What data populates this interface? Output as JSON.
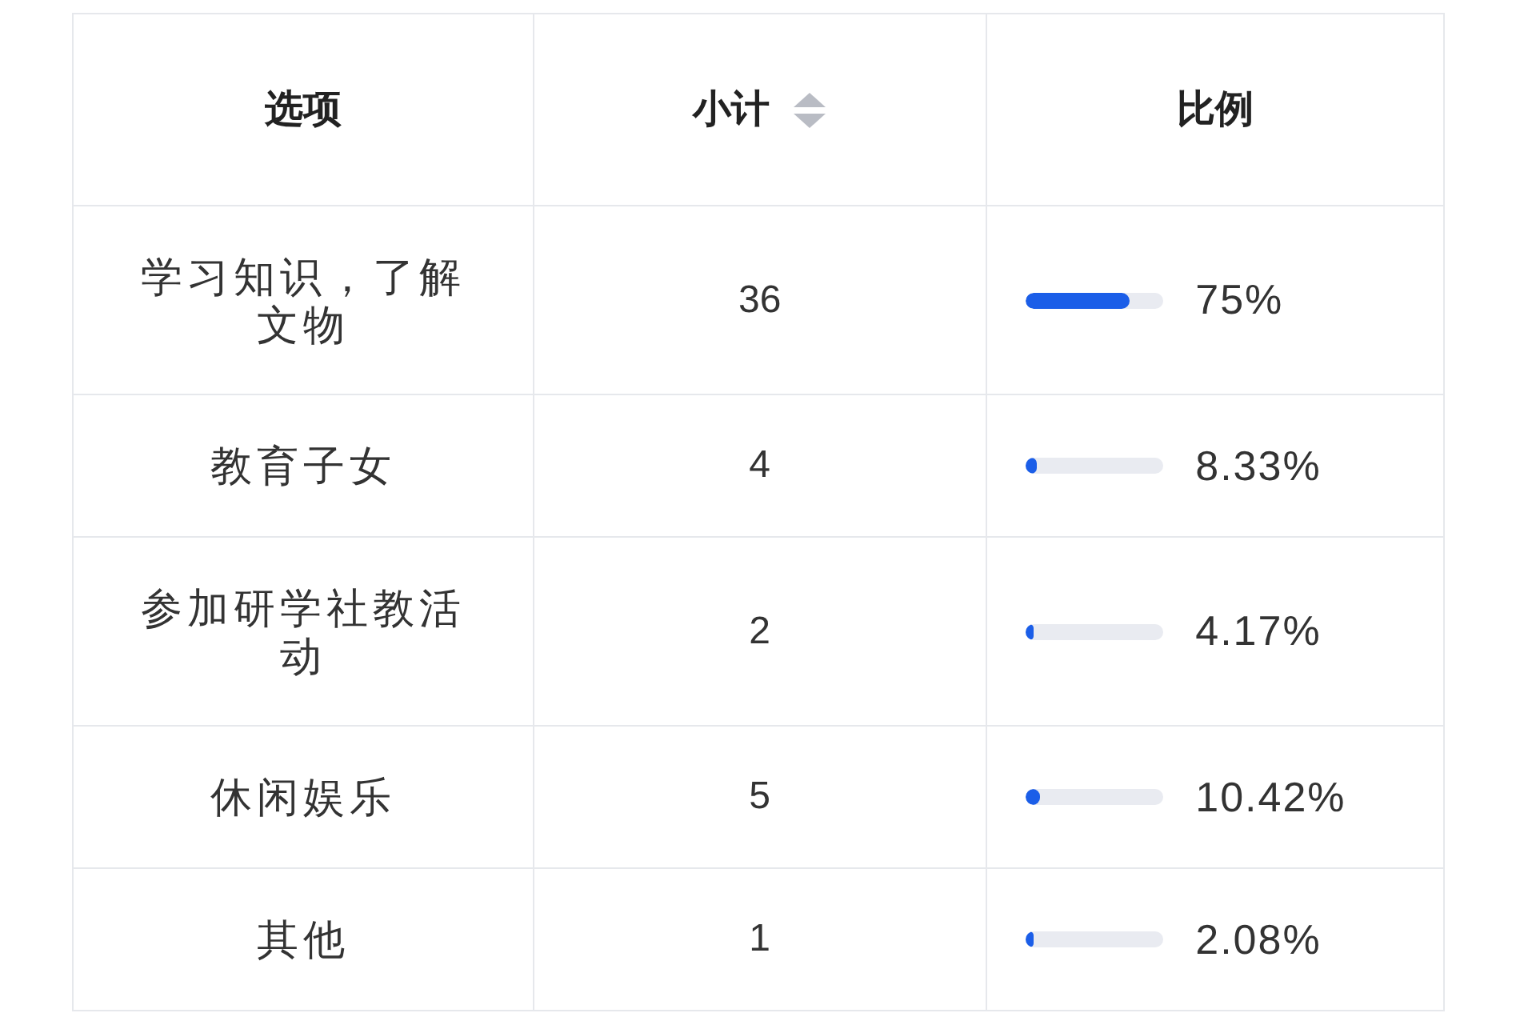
{
  "table": {
    "columns": [
      {
        "label": "选项",
        "sortable": false
      },
      {
        "label": "小计",
        "sortable": true
      },
      {
        "label": "比例",
        "sortable": false
      }
    ],
    "rows": [
      {
        "option": "学习知识，了解文物",
        "count": "36",
        "level": 0.75,
        "percent": "75%"
      },
      {
        "option": "教育子女",
        "count": "4",
        "level": 0.0833,
        "percent": "8.33%"
      },
      {
        "option": "参加研学社教活动",
        "count": "2",
        "level": 0.0417,
        "percent": "4.17%"
      },
      {
        "option": "休闲娱乐",
        "count": "5",
        "level": 0.1042,
        "percent": "10.42%"
      },
      {
        "option": "其他",
        "count": "1",
        "level": 0.0208,
        "percent": "2.08%"
      }
    ]
  }
}
